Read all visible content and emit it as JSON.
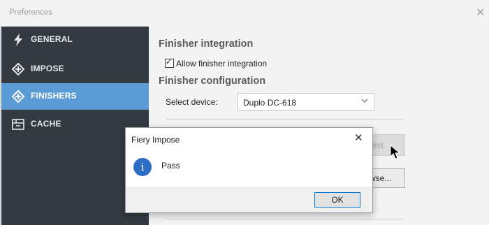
{
  "window": {
    "title": "Preferences",
    "close_glyph": "✕"
  },
  "sidebar": {
    "items": [
      {
        "label": "GENERAL",
        "icon": "lightning-icon"
      },
      {
        "label": "IMPOSE",
        "icon": "impose-icon"
      },
      {
        "label": "FINISHERS",
        "icon": "finishers-icon",
        "active": true
      },
      {
        "label": "CACHE",
        "icon": "cache-icon"
      }
    ],
    "active_color": "#5a9bd5",
    "background_color": "#343a42"
  },
  "content": {
    "integration_heading": "Finisher integration",
    "allow_label": "Allow finisher integration",
    "allow_checked": true,
    "config_heading": "Finisher configuration",
    "device_label": "Select device:",
    "device_value": "Duplo DC-618",
    "test_button": "Test",
    "test_button_visible": "est",
    "browse_button": "Browse...",
    "browse_button_visible": "wse..."
  },
  "dialog": {
    "title": "Fiery Impose",
    "message": "Pass",
    "ok_label": "OK",
    "close_glyph": "✕",
    "icon": "info-icon",
    "icon_glyph": "i"
  }
}
